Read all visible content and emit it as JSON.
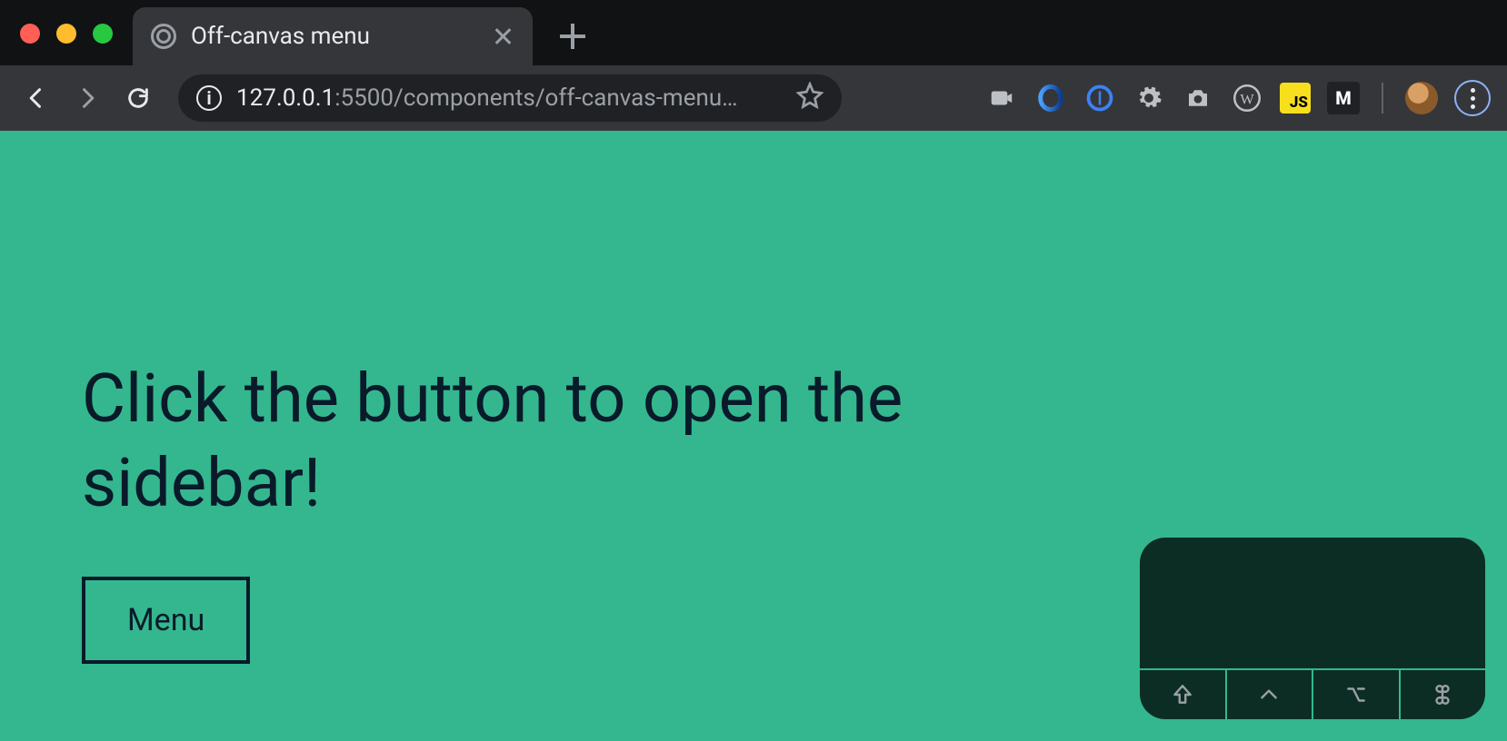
{
  "browser": {
    "tab_title": "Off-canvas menu",
    "url_host": "127.0.0.1",
    "url_port_path": ":5500/components/off-canvas-menu…",
    "extensions": [
      {
        "name": "screen-recorder-icon"
      },
      {
        "name": "opera-icon"
      },
      {
        "name": "onepassword-icon"
      },
      {
        "name": "settings-gear-icon"
      },
      {
        "name": "camera-icon"
      },
      {
        "name": "wikipedia-icon"
      },
      {
        "name": "js-icon",
        "label": "JS"
      },
      {
        "name": "gmail-icon",
        "label": "M"
      }
    ]
  },
  "page": {
    "headline": "Click the button to open the sidebar!",
    "menu_button_label": "Menu"
  },
  "overlay": {
    "keys": [
      "shift",
      "caret",
      "option",
      "command"
    ]
  },
  "colors": {
    "page_bg": "#34b78e",
    "page_fg": "#091a2a",
    "chrome_bg": "#35363a",
    "chrome_dark": "#202124",
    "overlay_bg": "#0c2d23"
  }
}
